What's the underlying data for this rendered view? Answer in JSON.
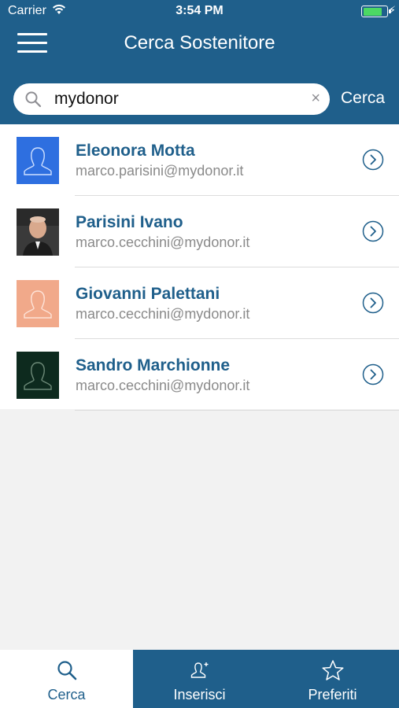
{
  "status_bar": {
    "carrier": "Carrier",
    "time": "3:54 PM",
    "battery_level": 0.85
  },
  "header": {
    "title": "Cerca Sostenitore"
  },
  "search": {
    "value": "mydonor",
    "clear_glyph": "×",
    "submit_label": "Cerca"
  },
  "results": [
    {
      "name": "Eleonora Motta",
      "email": "marco.parisini@mydonor.it",
      "avatar": "placeholder-blue",
      "avatar_bg": "#2e6fe0",
      "avatar_fg": "#cfe0ff"
    },
    {
      "name": "Parisini Ivano",
      "email": "marco.cecchini@mydonor.it",
      "avatar": "photo",
      "avatar_bg": "#3a3a3a",
      "avatar_fg": "#d9a98d"
    },
    {
      "name": "Giovanni Palettani",
      "email": "marco.cecchini@mydonor.it",
      "avatar": "placeholder-peach",
      "avatar_bg": "#f1a98a",
      "avatar_fg": "#fde3d8"
    },
    {
      "name": "Sandro Marchionne",
      "email": "marco.cecchini@mydonor.it",
      "avatar": "placeholder-dark",
      "avatar_bg": "#0d2a1e",
      "avatar_fg": "#6d8a78"
    }
  ],
  "tabs": [
    {
      "label": "Cerca",
      "icon": "search-icon",
      "active": true
    },
    {
      "label": "Inserisci",
      "icon": "add-person-icon",
      "active": false
    },
    {
      "label": "Preferiti",
      "icon": "star-icon",
      "active": false
    }
  ],
  "colors": {
    "primary": "#1f5f8b",
    "background": "#f2f2f2",
    "secondary_text": "#8a8a8a"
  }
}
